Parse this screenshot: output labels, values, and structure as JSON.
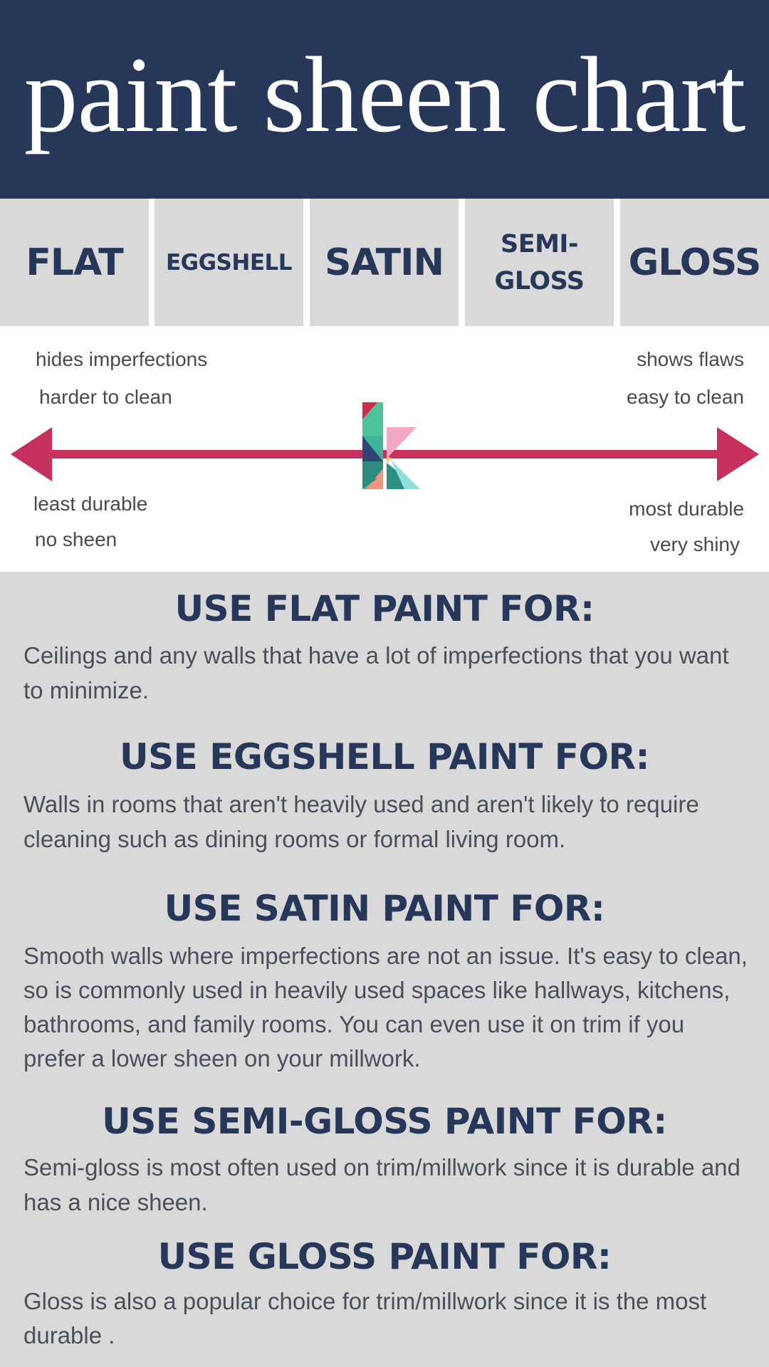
{
  "header": {
    "title": "paint sheen chart",
    "background_color": "#26375a"
  },
  "sheens": [
    {
      "label": "FLAT"
    },
    {
      "label": "EGGSHELL"
    },
    {
      "label": "SATIN"
    },
    {
      "label_line1": "SEMI-",
      "label_line2": "GLOSS"
    },
    {
      "label": "GLOSS"
    }
  ],
  "scale": {
    "arrow_color": "#c7305c",
    "left_top": [
      "hides imperfections",
      "harder to clean"
    ],
    "left_bottom": [
      "least durable",
      "no sheen"
    ],
    "right_top": [
      "shows flaws",
      "easy to clean"
    ],
    "right_bottom": [
      "most durable",
      "very shiny"
    ],
    "logo_icon": "k-logo-icon"
  },
  "uses": [
    {
      "heading": "USE FLAT PAINT FOR:",
      "lines": [
        "Ceilings and any walls that have a lot of imperfections that you want",
        "to minimize."
      ]
    },
    {
      "heading": "USE EGGSHELL PAINT FOR:",
      "lines": [
        "Walls in rooms that aren't heavily used and aren't likely to require",
        "cleaning such as dining rooms or formal living room."
      ]
    },
    {
      "heading": "USE SATIN PAINT FOR:",
      "lines": [
        "Smooth walls where imperfections are not an issue. It's easy to clean,",
        "so is commonly used in heavily used spaces like hallways, kitchens,",
        "bathrooms, and family rooms. You can even use it on trim if you",
        "prefer a lower sheen on your millwork."
      ]
    },
    {
      "heading": "USE SEMI-GLOSS PAINT FOR:",
      "lines": [
        "Semi-gloss is most often used on trim/millwork since it is durable and",
        "has a nice sheen."
      ]
    },
    {
      "heading": "USE GLOSS PAINT FOR:",
      "lines": [
        "Gloss is also a popular choice for trim/millwork since it is the most",
        "durable ."
      ]
    }
  ]
}
